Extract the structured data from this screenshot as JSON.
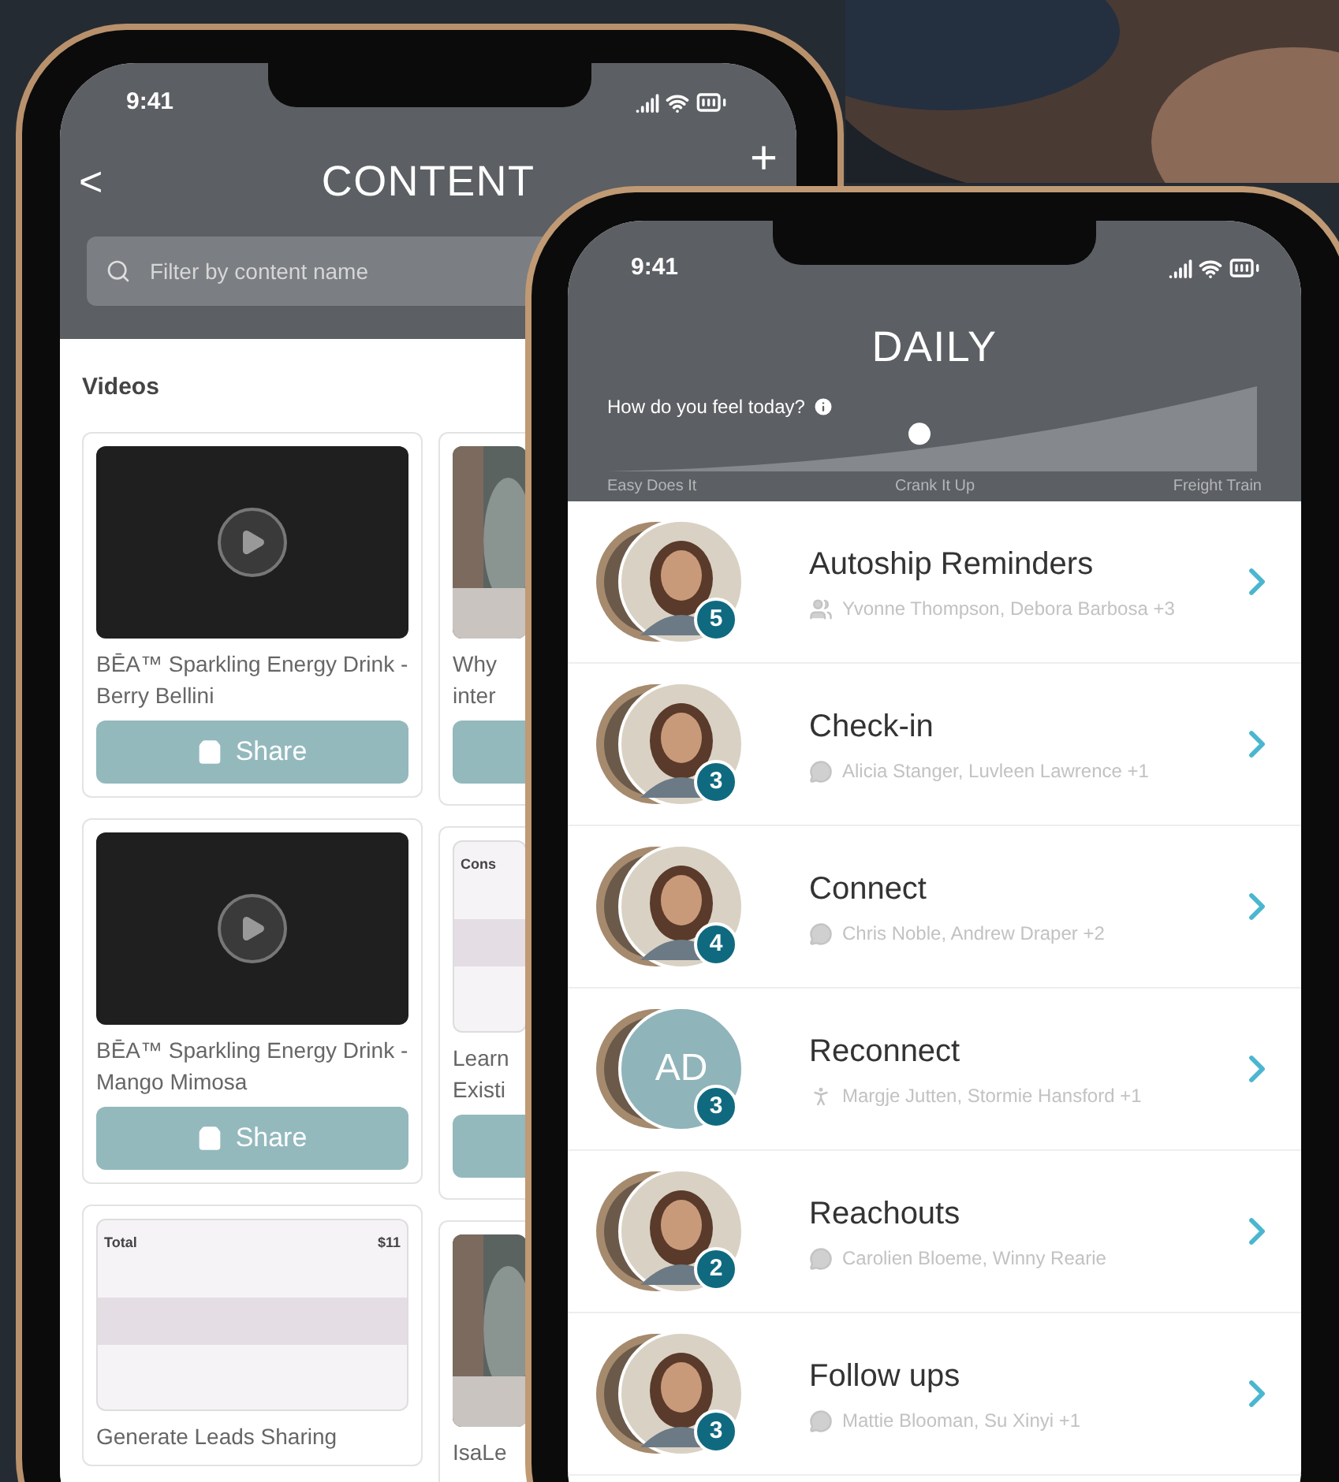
{
  "content_phone": {
    "time": "9:41",
    "back": "<",
    "title": "CONTENT",
    "add": "+",
    "search": {
      "placeholder": "Filter by content name"
    },
    "section": "Videos",
    "cards": [
      {
        "kind": "video",
        "title": "BĒA™ Sparkling Energy Drink - Berry Bellini",
        "button": "Share"
      },
      {
        "kind": "video",
        "title": "BĒA™ Sparkling Energy Drink - Mango Mimosa",
        "button": "Share"
      },
      {
        "kind": "screenshot",
        "thumb_texts": [
          "Total",
          "$11"
        ],
        "title": "Generate Leads Sharing"
      }
    ],
    "cut_cards": [
      {
        "kind": "picture",
        "lines": [
          "Why",
          "inter"
        ],
        "has_button": true
      },
      {
        "kind": "screenshot",
        "thumb_texts": [
          "Cons"
        ],
        "lines": [
          "Learn",
          "Existi"
        ],
        "has_button": true
      },
      {
        "kind": "picture",
        "lines": [
          "IsaLe"
        ],
        "has_button": false
      }
    ]
  },
  "daily_phone": {
    "time": "9:41",
    "title": "DAILY",
    "mood": {
      "prompt": "How do you feel today?",
      "level": 0.5,
      "labels": [
        "Easy Does It",
        "Crank It Up",
        "Freight Train"
      ]
    },
    "rows": [
      {
        "title": "Autoship Reminders",
        "people": "Yvonne Thompson, Debora Barbosa +3",
        "count": "5"
      },
      {
        "title": "Check-in",
        "people": "Alicia Stanger, Luvleen Lawrence +1",
        "count": "3"
      },
      {
        "title": "Connect",
        "people": "Chris Noble, Andrew Draper +2",
        "count": "4"
      },
      {
        "title": "Reconnect",
        "people": "Margje Jutten, Stormie Hansford +1",
        "count": "3",
        "avatar": {
          "kind": "initials",
          "text": "AD"
        }
      },
      {
        "title": "Reachouts",
        "people": "Carolien Bloeme, Winny Rearie",
        "count": "2"
      },
      {
        "title": "Follow ups",
        "people": "Mattie Blooman, Su Xinyi +1",
        "count": "3"
      }
    ]
  }
}
